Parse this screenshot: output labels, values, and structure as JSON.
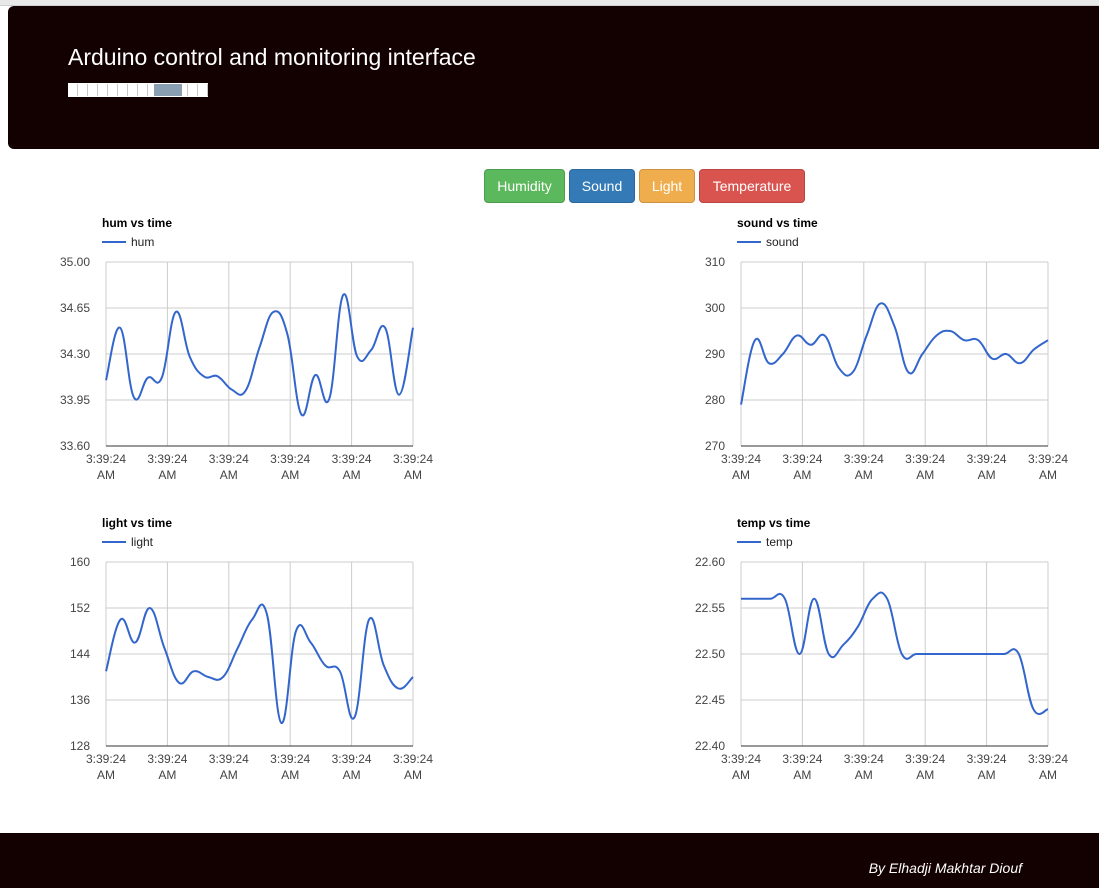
{
  "header": {
    "title": "Arduino control and monitoring interface",
    "progress": 0.8
  },
  "buttons": [
    {
      "label": "Humidity",
      "color": "#5cb85c"
    },
    {
      "label": "Sound",
      "color": "#337ab7"
    },
    {
      "label": "Light",
      "color": "#f0ad4e"
    },
    {
      "label": "Temperature",
      "color": "#d9534f"
    }
  ],
  "footer": {
    "credit": "By Elhadji Makhtar Diouf"
  },
  "chart_data": [
    {
      "type": "line",
      "title": "hum vs time",
      "series": [
        {
          "name": "hum",
          "color": "#3366cc",
          "values": [
            34.1,
            34.5,
            33.97,
            34.12,
            34.12,
            34.62,
            34.28,
            34.13,
            34.13,
            34.03,
            34.02,
            34.35,
            34.62,
            34.45,
            33.84,
            34.14,
            33.96,
            34.75,
            34.28,
            34.33,
            34.5,
            33.99,
            34.5
          ]
        }
      ],
      "x_tick_labels": [
        "3:39:24 AM",
        "3:39:24 AM",
        "3:39:24 AM",
        "3:39:24 AM",
        "3:39:24 AM",
        "3:39:24 AM"
      ],
      "y_ticks": [
        "35.00",
        "34.65",
        "34.30",
        "33.95",
        "33.60"
      ],
      "ylim": [
        33.6,
        35.0
      ],
      "grid": true,
      "legend": "top-left"
    },
    {
      "type": "line",
      "title": "sound vs time",
      "series": [
        {
          "name": "sound",
          "color": "#3366cc",
          "values": [
            279,
            293,
            288,
            290,
            294,
            292,
            294,
            287,
            286,
            294,
            301,
            296,
            286,
            290,
            294,
            295,
            293,
            293,
            289,
            290,
            288,
            291,
            293
          ]
        }
      ],
      "x_tick_labels": [
        "3:39:24 AM",
        "3:39:24 AM",
        "3:39:24 AM",
        "3:39:24 AM",
        "3:39:24 AM",
        "3:39:24 AM"
      ],
      "y_ticks": [
        "310",
        "300",
        "290",
        "280",
        "270"
      ],
      "ylim": [
        270,
        310
      ],
      "grid": true,
      "legend": "top-left"
    },
    {
      "type": "line",
      "title": "light vs time",
      "series": [
        {
          "name": "light",
          "color": "#3366cc",
          "values": [
            141,
            150,
            146,
            152,
            145,
            139,
            141,
            140,
            140,
            145,
            150,
            151,
            132,
            148,
            146,
            142,
            141,
            133,
            150,
            142,
            138,
            140
          ]
        }
      ],
      "x_tick_labels": [
        "3:39:24 AM",
        "3:39:24 AM",
        "3:39:24 AM",
        "3:39:24 AM",
        "3:39:24 AM",
        "3:39:24 AM"
      ],
      "y_ticks": [
        "160",
        "152",
        "144",
        "136",
        "128"
      ],
      "ylim": [
        128,
        160
      ],
      "grid": true,
      "legend": "top-left"
    },
    {
      "type": "line",
      "title": "temp vs time",
      "series": [
        {
          "name": "temp",
          "color": "#3366cc",
          "values": [
            22.56,
            22.56,
            22.56,
            22.56,
            22.5,
            22.56,
            22.5,
            22.51,
            22.53,
            22.56,
            22.56,
            22.5,
            22.5,
            22.5,
            22.5,
            22.5,
            22.5,
            22.5,
            22.5,
            22.5,
            22.44,
            22.44
          ]
        }
      ],
      "x_tick_labels": [
        "3:39:24 AM",
        "3:39:24 AM",
        "3:39:24 AM",
        "3:39:24 AM",
        "3:39:24 AM",
        "3:39:24 AM"
      ],
      "y_ticks": [
        "22.60",
        "22.55",
        "22.50",
        "22.45",
        "22.40"
      ],
      "ylim": [
        22.4,
        22.6
      ],
      "grid": true,
      "legend": "top-left"
    }
  ]
}
